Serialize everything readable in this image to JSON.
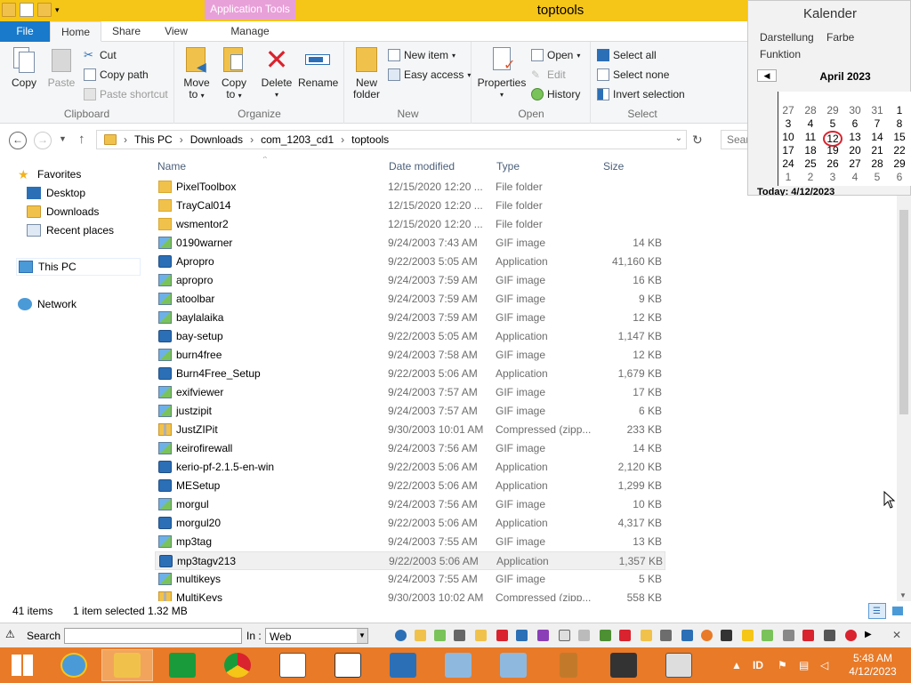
{
  "window": {
    "title": "toptools",
    "context_tab": "Application Tools"
  },
  "ribbon": {
    "tabs": [
      "File",
      "Home",
      "Share",
      "View",
      "Manage"
    ],
    "clipboard": {
      "label": "Clipboard",
      "copy": "Copy",
      "paste": "Paste",
      "cut": "Cut",
      "copy_path": "Copy path",
      "paste_shortcut": "Paste shortcut"
    },
    "organize": {
      "label": "Organize",
      "move_to_1": "Move",
      "move_to_2": "to",
      "copy_to_1": "Copy",
      "copy_to_2": "to",
      "delete": "Delete",
      "rename": "Rename"
    },
    "new": {
      "label": "New",
      "new_folder_1": "New",
      "new_folder_2": "folder",
      "new_item": "New item",
      "easy_access": "Easy access"
    },
    "open": {
      "label": "Open",
      "properties": "Properties",
      "open": "Open",
      "edit": "Edit",
      "history": "History"
    },
    "select": {
      "label": "Select",
      "select_all": "Select all",
      "select_none": "Select none",
      "invert_selection": "Invert selection"
    }
  },
  "address": {
    "crumbs": [
      "This PC",
      "Downloads",
      "com_1203_cd1",
      "toptools"
    ],
    "search_placeholder": "Sear"
  },
  "nav": {
    "favorites": "Favorites",
    "desktop": "Desktop",
    "downloads": "Downloads",
    "recent_places": "Recent places",
    "this_pc": "This PC",
    "network": "Network"
  },
  "columns": {
    "name": "Name",
    "date": "Date modified",
    "type": "Type",
    "size": "Size"
  },
  "files": [
    {
      "name": "PixelToolbox",
      "date": "12/15/2020 12:20 ...",
      "type": "File folder",
      "size": "",
      "icon": "folder-icon"
    },
    {
      "name": "TrayCal014",
      "date": "12/15/2020 12:20 ...",
      "type": "File folder",
      "size": "",
      "icon": "folder-icon"
    },
    {
      "name": "wsmentor2",
      "date": "12/15/2020 12:20 ...",
      "type": "File folder",
      "size": "",
      "icon": "folder-icon"
    },
    {
      "name": "0190warner",
      "date": "9/24/2003 7:43 AM",
      "type": "GIF image",
      "size": "14 KB",
      "icon": "gif-icon"
    },
    {
      "name": "Apropro",
      "date": "9/22/2003 5:05 AM",
      "type": "Application",
      "size": "41,160 KB",
      "icon": "app-icon"
    },
    {
      "name": "apropro",
      "date": "9/24/2003 7:59 AM",
      "type": "GIF image",
      "size": "16 KB",
      "icon": "gif-icon"
    },
    {
      "name": "atoolbar",
      "date": "9/24/2003 7:59 AM",
      "type": "GIF image",
      "size": "9 KB",
      "icon": "gif-icon"
    },
    {
      "name": "baylalaika",
      "date": "9/24/2003 7:59 AM",
      "type": "GIF image",
      "size": "12 KB",
      "icon": "gif-icon"
    },
    {
      "name": "bay-setup",
      "date": "9/22/2003 5:05 AM",
      "type": "Application",
      "size": "1,147 KB",
      "icon": "app-icon"
    },
    {
      "name": "burn4free",
      "date": "9/24/2003 7:58 AM",
      "type": "GIF image",
      "size": "12 KB",
      "icon": "gif-icon"
    },
    {
      "name": "Burn4Free_Setup",
      "date": "9/22/2003 5:06 AM",
      "type": "Application",
      "size": "1,679 KB",
      "icon": "app-icon"
    },
    {
      "name": "exifviewer",
      "date": "9/24/2003 7:57 AM",
      "type": "GIF image",
      "size": "17 KB",
      "icon": "gif-icon"
    },
    {
      "name": "justzipit",
      "date": "9/24/2003 7:57 AM",
      "type": "GIF image",
      "size": "6 KB",
      "icon": "gif-icon"
    },
    {
      "name": "JustZIPit",
      "date": "9/30/2003 10:01 AM",
      "type": "Compressed (zipp...",
      "size": "233 KB",
      "icon": "zip-icon"
    },
    {
      "name": "keirofirewall",
      "date": "9/24/2003 7:56 AM",
      "type": "GIF image",
      "size": "14 KB",
      "icon": "gif-icon"
    },
    {
      "name": "kerio-pf-2.1.5-en-win",
      "date": "9/22/2003 5:06 AM",
      "type": "Application",
      "size": "2,120 KB",
      "icon": "app-icon"
    },
    {
      "name": "MESetup",
      "date": "9/22/2003 5:06 AM",
      "type": "Application",
      "size": "1,299 KB",
      "icon": "app-icon"
    },
    {
      "name": "morgul",
      "date": "9/24/2003 7:56 AM",
      "type": "GIF image",
      "size": "10 KB",
      "icon": "gif-icon"
    },
    {
      "name": "morgul20",
      "date": "9/22/2003 5:06 AM",
      "type": "Application",
      "size": "4,317 KB",
      "icon": "app-icon"
    },
    {
      "name": "mp3tag",
      "date": "9/24/2003 7:55 AM",
      "type": "GIF image",
      "size": "13 KB",
      "icon": "gif-icon"
    },
    {
      "name": "mp3tagv213",
      "date": "9/22/2003 5:06 AM",
      "type": "Application",
      "size": "1,357 KB",
      "icon": "app-icon",
      "selected": true
    },
    {
      "name": "multikeys",
      "date": "9/24/2003 7:55 AM",
      "type": "GIF image",
      "size": "5 KB",
      "icon": "gif-icon"
    },
    {
      "name": "MultiKeys",
      "date": "9/30/2003 10:02 AM",
      "type": "Compressed (zipp...",
      "size": "558 KB",
      "icon": "zip-icon"
    }
  ],
  "status": {
    "count": "41 items",
    "selection": "1 item selected  1.32 MB"
  },
  "searchbar": {
    "search_label": "Search :",
    "in_label": "In :",
    "in_value": "Web"
  },
  "calendar": {
    "title": "Kalender",
    "menu": [
      "Darstellung",
      "Farbe",
      "Funktion"
    ],
    "month": "April 2023",
    "weeks": [
      [
        "27",
        "28",
        "29",
        "30",
        "31",
        "1"
      ],
      [
        "3",
        "4",
        "5",
        "6",
        "7",
        "8"
      ],
      [
        "10",
        "11",
        "12",
        "13",
        "14",
        "15"
      ],
      [
        "17",
        "18",
        "19",
        "20",
        "21",
        "22"
      ],
      [
        "24",
        "25",
        "26",
        "27",
        "28",
        "29"
      ],
      [
        "1",
        "2",
        "3",
        "4",
        "5",
        "6"
      ]
    ],
    "today": "12",
    "footer": "Today: 4/12/2023"
  },
  "taskbar": {
    "time": "5:48 AM",
    "date": "4/12/2023",
    "lang": "ID"
  }
}
